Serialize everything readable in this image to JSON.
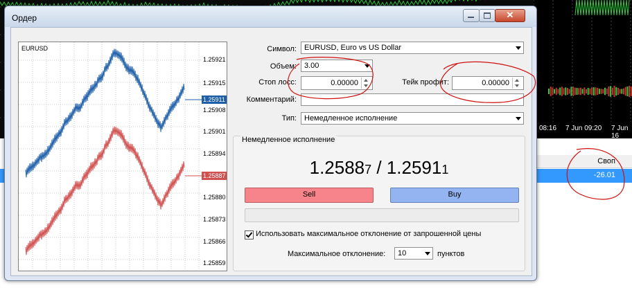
{
  "background": {
    "time_labels": [
      "08:16",
      "7 Jun 09:20",
      "7 Jun 16"
    ],
    "table_header": "Своп",
    "selected_row_value": "-26.01"
  },
  "dialog": {
    "title": "Ордер",
    "close_glyph": "✕"
  },
  "mini_chart": {
    "symbol": "EURUSD",
    "price_ticks": [
      "1.25921",
      "1.25915",
      "1.25908",
      "1.25901",
      "1.25894",
      "1.25880",
      "1.25873",
      "1.25866",
      "1.25859"
    ],
    "ask_label": "1.25911",
    "bid_label": "1.25887",
    "ask_color": "#1f5fa8",
    "bid_color": "#d05050"
  },
  "form": {
    "symbol_label": "Символ:",
    "symbol_value": "EURUSD, Euro vs US Dollar",
    "volume_label": "Объем:",
    "volume_value": "3.00",
    "stop_loss_label": "Стоп лосс:",
    "stop_loss_value": "0.00000",
    "take_profit_label": "Тейк профит:",
    "take_profit_value": "0.00000",
    "comment_label": "Комментарий:",
    "comment_value": "",
    "type_label": "Тип:",
    "type_value": "Немедленное исполнение"
  },
  "execution": {
    "group_title": "Немедленное исполнение",
    "bid_main": "1.2588",
    "bid_small": "7",
    "separator": " / ",
    "ask_main": "1.2591",
    "ask_small": "1",
    "sell_label": "Sell",
    "buy_label": "Buy",
    "use_max_deviation_label": "Использовать максимальное отклонение от запрошенной цены",
    "use_max_deviation_checked": true,
    "max_deviation_label": "Максимальное отклонение:",
    "max_deviation_value": "10",
    "units_label": "пунктов"
  }
}
